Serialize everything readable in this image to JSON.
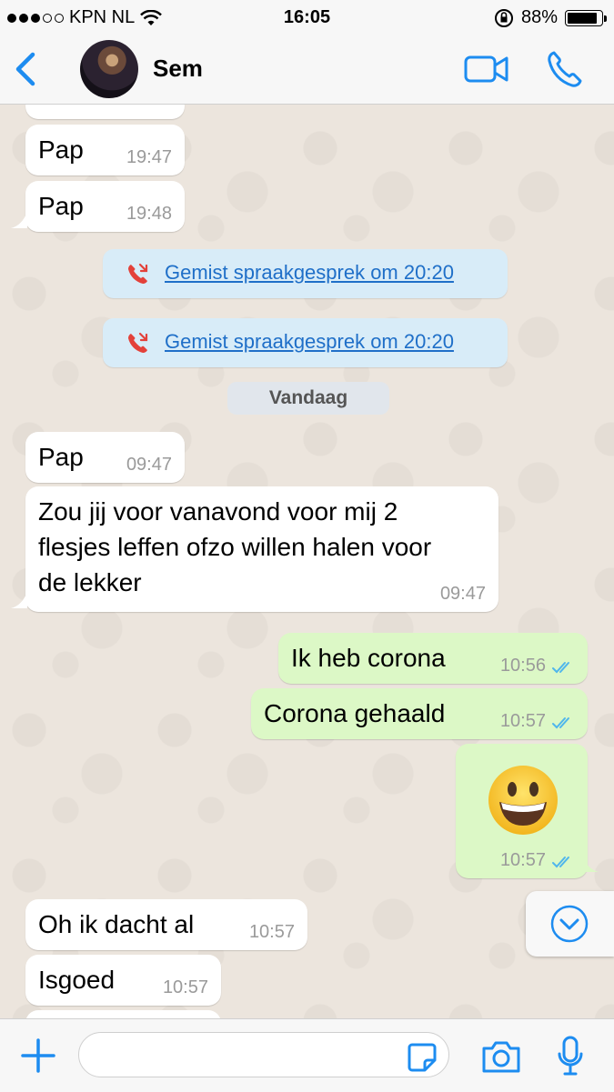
{
  "status_bar": {
    "carrier": "KPN NL",
    "time": "16:05",
    "battery": "88%",
    "battery_level": 0.88
  },
  "header": {
    "back_icon": "chevron-left-icon",
    "contact_name": "Sem",
    "video_icon": "video-camera-icon",
    "call_icon": "phone-icon",
    "accent": "#1d8cf0"
  },
  "messages_before": [
    {
      "text": "Pap",
      "time": "19:47"
    },
    {
      "text": "Pap",
      "time": "19:48"
    }
  ],
  "missed_calls": [
    {
      "label": "Gemist spraakgesprek om 20:20"
    },
    {
      "label": "Gemist spraakgesprek om 20:20"
    }
  ],
  "date_divider": "Vandaag",
  "messages_today": [
    {
      "text": "Pap",
      "time": "09:47",
      "direction": "in"
    },
    {
      "text": "Zou jij voor vanavond voor mij 2\nflesjes leffen ofzo willen halen voor\nde lekker",
      "time": "09:47",
      "direction": "in"
    },
    {
      "text": "Ik heb corona",
      "time": "10:56",
      "direction": "out"
    },
    {
      "text": "Corona gehaald",
      "time": "10:57",
      "direction": "out"
    },
    {
      "text": "",
      "emoji": "grinning-face",
      "time": "10:57",
      "direction": "out"
    },
    {
      "text": "Oh ik dacht al",
      "time": "10:57",
      "direction": "in"
    },
    {
      "text": "Isgoed",
      "time": "10:57",
      "direction": "in"
    }
  ],
  "input_bar": {
    "plus_icon": "plus-icon",
    "sticker_icon": "sticker-icon",
    "camera_icon": "camera-icon",
    "mic_icon": "microphone-icon",
    "placeholder": ""
  },
  "colors": {
    "outgoing_bubble": "#dcf8c6",
    "incoming_bubble": "#ffffff",
    "missed_call_bg": "#d8ecf8",
    "read_ticks": "#4fb6ec"
  }
}
